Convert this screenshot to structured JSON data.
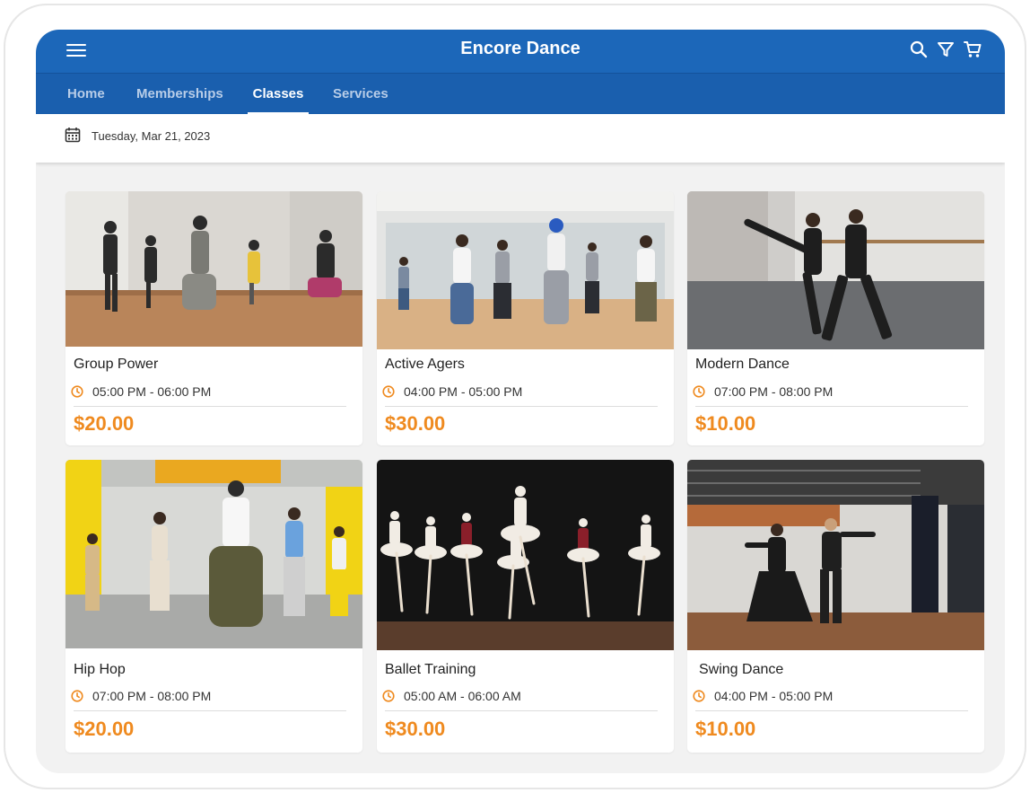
{
  "app": {
    "title": "Encore Dance"
  },
  "icons": {
    "menu": "hamburger-menu-icon",
    "search": "search-icon",
    "filter": "filter-icon",
    "cart": "cart-icon",
    "calendar": "calendar-icon",
    "clock": "clock-icon"
  },
  "tabs": [
    {
      "label": "Home"
    },
    {
      "label": "Memberships"
    },
    {
      "label": "Classes",
      "active": true
    },
    {
      "label": "Services"
    }
  ],
  "date": {
    "label": "Tuesday, Mar 21, 2023"
  },
  "colors": {
    "header": "#1c67b9",
    "tabbar": "#1a5fae",
    "price": "#ef8a1f",
    "clock": "#ef8a1f"
  },
  "classes": [
    {
      "name": "Group Power",
      "time": "05:00 PM - 06:00 PM",
      "price": "$20.00"
    },
    {
      "name": "Active Agers",
      "time": "04:00 PM - 05:00 PM",
      "price": "$30.00"
    },
    {
      "name": "Modern Dance",
      "time": "07:00 PM - 08:00 PM",
      "price": "$10.00"
    },
    {
      "name": "Hip Hop",
      "time": "07:00 PM - 08:00 PM",
      "price": "$20.00"
    },
    {
      "name": "Ballet Training",
      "time": "05:00 AM - 06:00 AM",
      "price": "$30.00"
    },
    {
      "name": "Swing Dance",
      "time": "04:00 PM - 05:00 PM",
      "price": "$10.00"
    }
  ]
}
